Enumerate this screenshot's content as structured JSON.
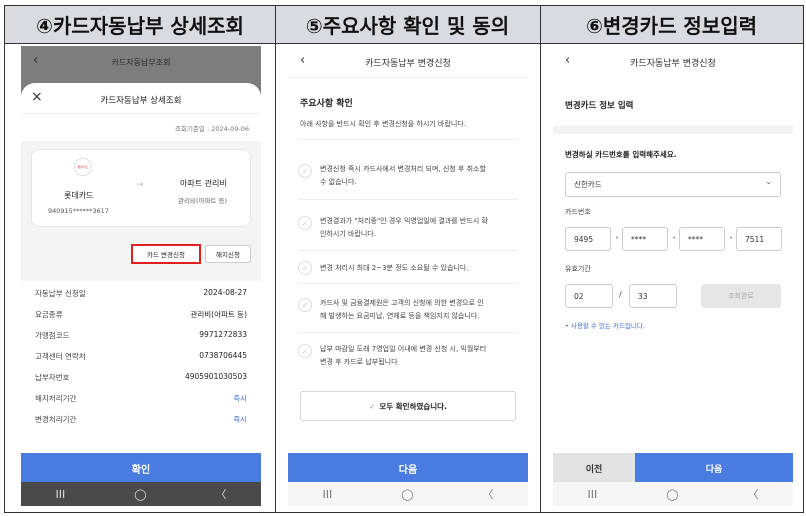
{
  "headers": {
    "panel4": "④카드자동납부 상세조회",
    "panel5": "⑤주요사항 확인 및 동의",
    "panel6": "⑥변경카드 정보입력"
  },
  "panel4": {
    "bg_title": "카드자동납부조회",
    "sheet_title": "카드자동납부 상세조회",
    "query_date": "조회기준일 : 2024-09-06",
    "card_logo_text": "롯데카드",
    "card_name": "롯데카드",
    "card_number": "940915******3617",
    "arrow": "→",
    "target_name": "아파트 관리비",
    "target_sub": "관리비(아파트 등)",
    "btn_change": "카드 변경신청",
    "btn_cancel": "해지신청",
    "rows": [
      {
        "label": "자동납부 신청일",
        "value": "2024-08-27"
      },
      {
        "label": "요금종류",
        "value": "관리비(아파트 등)"
      },
      {
        "label": "가맹점코드",
        "value": "9971272833"
      },
      {
        "label": "고객센터 연락처",
        "value": "0738706445"
      },
      {
        "label": "납부자번호",
        "value": "4905901030503"
      },
      {
        "label": "해지처리기간",
        "value": "즉시"
      },
      {
        "label": "변경처리기간",
        "value": "즉시"
      }
    ],
    "confirm": "확인"
  },
  "panel5": {
    "top_title": "카드자동납부 변경신청",
    "section_title": "주요사항 확인",
    "desc": "아래 사항을 반드시 확인 후 변경신청을 하시기 바랍니다.",
    "items": [
      {
        "l1": "변경신청 즉시 카드사에서 변경처리 되며, 신청 후 취소할",
        "l2": "수 없습니다."
      },
      {
        "l1": "변경결과가 \"처리중\"인 경우 익영업일에 결과를 반드시 확",
        "l2": "인하시기 바랍니다."
      },
      {
        "l1": "변경 처리시 최대 2~3분 정도 소요될 수 있습니다.",
        "l2": ""
      },
      {
        "l1": "카드사 및 금융결제원은 고객의 신청에 의한 변경으로 인",
        "l2": "해 발생하는 요금미납, 연체료 등을 책임지지 않습니다."
      },
      {
        "l1": "납부 마감일 도래 7영업일 이내에 변경 신청 시, 익월부터",
        "l2": "변경 후 카드로 납부됩니다"
      }
    ],
    "confirm_all": "모두 확인하였습니다.",
    "next": "다음"
  },
  "panel6": {
    "top_title": "카드자동납부 변경신청",
    "section_title": "변경카드 정보 입력",
    "prompt": "변경하실 카드번호를 입력해주세요.",
    "card_company": "신한카드",
    "card_number_label": "카드번호",
    "card_parts": [
      "9495",
      "****",
      "****",
      "7511"
    ],
    "expiry_label": "유효기간",
    "expiry_month": "02",
    "expiry_sep": "/",
    "expiry_year": "33",
    "lookup_btn": "조회완료",
    "usable_note": "• 사용할 수 있는 카드입니다.",
    "prev": "이전",
    "next": "다음"
  },
  "nav": {
    "recents": "III",
    "home": "◯",
    "back": "〈"
  }
}
